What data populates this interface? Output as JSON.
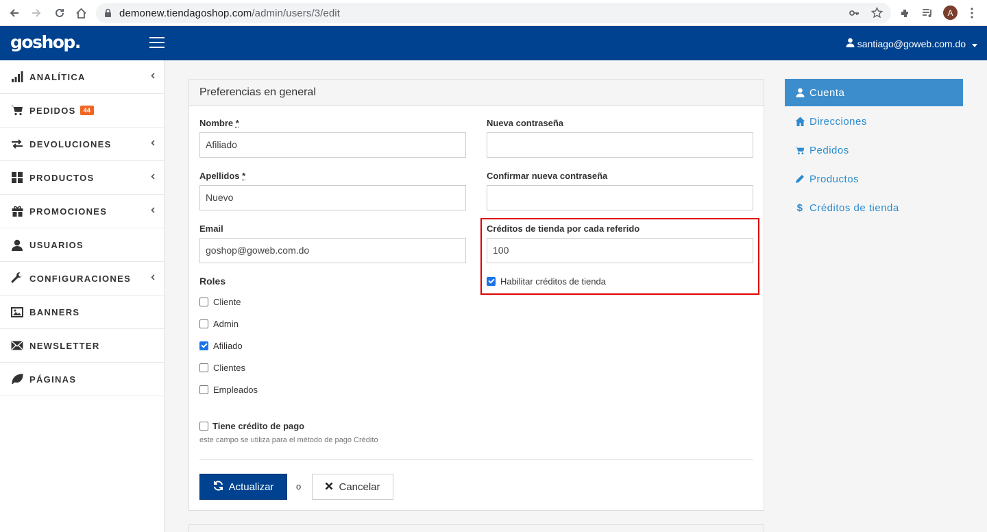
{
  "browser": {
    "url_host": "demonew.tiendagoshop.com",
    "url_path": "/admin/users/3/edit",
    "profile_initial": "A"
  },
  "header": {
    "logo": "goshop.",
    "user_email": "santiago@goweb.com.do"
  },
  "sidebar": {
    "items": [
      {
        "label": "ANALÍTICA",
        "icon": "bar-chart-icon",
        "chevron": true
      },
      {
        "label": "PEDIDOS",
        "icon": "shopping-cart-icon",
        "badge": "44",
        "chevron": false
      },
      {
        "label": "DEVOLUCIONES",
        "icon": "exchange-icon",
        "chevron": true
      },
      {
        "label": "PRODUCTOS",
        "icon": "grid-icon",
        "chevron": true
      },
      {
        "label": "PROMOCIONES",
        "icon": "gift-icon",
        "chevron": true
      },
      {
        "label": "USUARIOS",
        "icon": "user-icon",
        "chevron": false
      },
      {
        "label": "CONFIGURACIONES",
        "icon": "wrench-icon",
        "chevron": true
      },
      {
        "label": "BANNERS",
        "icon": "picture-icon",
        "chevron": false
      },
      {
        "label": "NEWSLETTER",
        "icon": "envelope-icon",
        "chevron": false
      },
      {
        "label": "PÁGINAS",
        "icon": "leaf-icon",
        "chevron": false
      }
    ]
  },
  "form": {
    "title": "Preferencias en general",
    "nombre": {
      "label": "Nombre",
      "required": "*",
      "value": "Afiliado"
    },
    "apellidos": {
      "label": "Apellidos",
      "required": "*",
      "value": "Nuevo"
    },
    "email": {
      "label": "Email",
      "value": "goshop@goweb.com.do"
    },
    "nueva_contrasena": {
      "label": "Nueva contraseña",
      "value": ""
    },
    "confirmar_contrasena": {
      "label": "Confirmar nueva contraseña",
      "value": ""
    },
    "creditos": {
      "label": "Créditos de tienda por cada referido",
      "value": "100"
    },
    "habilitar": {
      "label": "Habilitar créditos de tienda",
      "checked": true
    },
    "roles_label": "Roles",
    "roles": [
      {
        "label": "Cliente",
        "checked": false
      },
      {
        "label": "Admin",
        "checked": false
      },
      {
        "label": "Afiliado",
        "checked": true
      },
      {
        "label": "Clientes",
        "checked": false
      },
      {
        "label": "Empleados",
        "checked": false
      }
    ],
    "credito_pago": {
      "label": "Tiene crédito de pago",
      "checked": false,
      "help": "este campo se utiliza para el método de pago Crédito"
    },
    "submit_label": "Actualizar",
    "or_text": "o",
    "cancel_label": "Cancelar"
  },
  "right_nav": [
    {
      "label": "Cuenta",
      "icon": "user-icon",
      "active": true
    },
    {
      "label": "Direcciones",
      "icon": "home-icon",
      "active": false
    },
    {
      "label": "Pedidos",
      "icon": "shopping-cart-icon",
      "active": false
    },
    {
      "label": "Productos",
      "icon": "pencil-icon",
      "active": false
    },
    {
      "label": "Créditos de tienda",
      "icon": "dollar-icon",
      "active": false
    }
  ],
  "colors": {
    "topbar": "#004290",
    "primary_button": "#004290",
    "active_nav": "#3c8dcb",
    "link": "#2a8bd0",
    "badge": "#f26522",
    "highlight_border": "#e00000"
  }
}
